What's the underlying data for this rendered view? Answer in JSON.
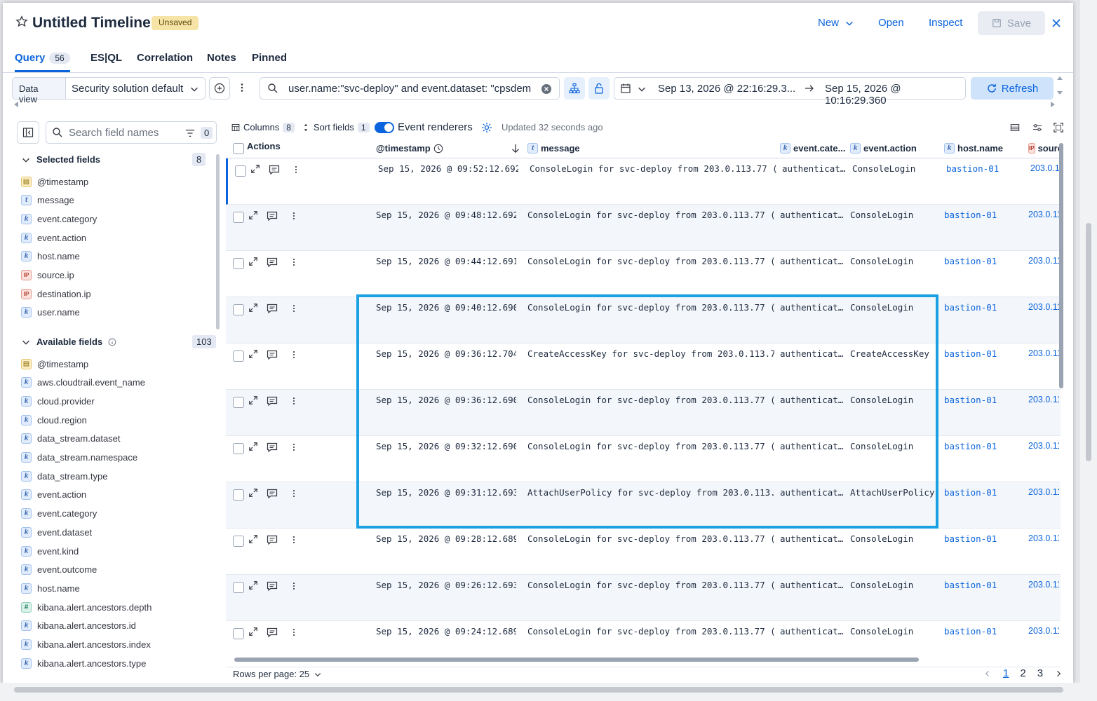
{
  "header": {
    "title": "Untitled Timeline",
    "badge": "Unsaved",
    "new_label": "New",
    "open_label": "Open",
    "inspect_label": "Inspect",
    "save_label": "Save"
  },
  "tabs": [
    {
      "label": "Query",
      "count": "56",
      "active": true
    },
    {
      "label": "ES|QL"
    },
    {
      "label": "Correlation"
    },
    {
      "label": "Notes"
    },
    {
      "label": "Pinned"
    }
  ],
  "querybar": {
    "dataview_label": "Data view",
    "dataview_value": "Security solution default",
    "kql_value": "user.name:\"svc-deploy\" and event.dataset: \"cpsdem",
    "date_start": "Sep 13, 2026 @ 22:16:29.3...",
    "date_end": "Sep 15, 2026 @ 10:16:29.360",
    "refresh_label": "Refresh"
  },
  "sidebar": {
    "search_placeholder": "Search field names",
    "filter_count": "0",
    "selected_label": "Selected fields",
    "selected_count": "8",
    "selected_fields": [
      {
        "type": "d",
        "name": "@timestamp"
      },
      {
        "type": "t",
        "name": "message"
      },
      {
        "type": "k",
        "name": "event.category"
      },
      {
        "type": "k",
        "name": "event.action"
      },
      {
        "type": "k",
        "name": "host.name"
      },
      {
        "type": "ip",
        "name": "source.ip"
      },
      {
        "type": "ip",
        "name": "destination.ip"
      },
      {
        "type": "k",
        "name": "user.name"
      }
    ],
    "available_label": "Available fields",
    "available_count": "103",
    "available_fields": [
      {
        "type": "d",
        "name": "@timestamp"
      },
      {
        "type": "k",
        "name": "aws.cloudtrail.event_name"
      },
      {
        "type": "k",
        "name": "cloud.provider"
      },
      {
        "type": "k",
        "name": "cloud.region"
      },
      {
        "type": "k",
        "name": "data_stream.dataset"
      },
      {
        "type": "k",
        "name": "data_stream.namespace"
      },
      {
        "type": "k",
        "name": "data_stream.type"
      },
      {
        "type": "k",
        "name": "event.action"
      },
      {
        "type": "k",
        "name": "event.category"
      },
      {
        "type": "k",
        "name": "event.dataset"
      },
      {
        "type": "k",
        "name": "event.kind"
      },
      {
        "type": "k",
        "name": "event.outcome"
      },
      {
        "type": "k",
        "name": "host.name"
      },
      {
        "type": "n",
        "name": "kibana.alert.ancestors.depth"
      },
      {
        "type": "k",
        "name": "kibana.alert.ancestors.id"
      },
      {
        "type": "k",
        "name": "kibana.alert.ancestors.index"
      },
      {
        "type": "k",
        "name": "kibana.alert.ancestors.type"
      }
    ]
  },
  "grid": {
    "columns_label": "Columns",
    "columns_count": "8",
    "sort_label": "Sort fields",
    "sort_count": "1",
    "renderers_label": "Event renderers",
    "updated_text": "Updated 32 seconds ago",
    "headers": {
      "actions": "Actions",
      "timestamp": "@timestamp",
      "message": "message",
      "category": "event.cate...",
      "action": "event.action",
      "host": "host.name",
      "source": "sourc"
    },
    "rows": [
      {
        "ts": "Sep 15, 2026 @ 09:52:12.692",
        "msg": "ConsoleLogin for svc-deploy from 203.0.113.77 (…",
        "cat": "authenticat…",
        "act": "ConsoleLogin",
        "host": "bastion-01",
        "src": "203.0.11"
      },
      {
        "ts": "Sep 15, 2026 @ 09:48:12.692",
        "msg": "ConsoleLogin for svc-deploy from 203.0.113.77 (…",
        "cat": "authenticat…",
        "act": "ConsoleLogin",
        "host": "bastion-01",
        "src": "203.0.11"
      },
      {
        "ts": "Sep 15, 2026 @ 09:44:12.691",
        "msg": "ConsoleLogin for svc-deploy from 203.0.113.77 (…",
        "cat": "authenticat…",
        "act": "ConsoleLogin",
        "host": "bastion-01",
        "src": "203.0.11"
      },
      {
        "ts": "Sep 15, 2026 @ 09:40:12.690",
        "msg": "ConsoleLogin for svc-deploy from 203.0.113.77 (…",
        "cat": "authenticat…",
        "act": "ConsoleLogin",
        "host": "bastion-01",
        "src": "203.0.11"
      },
      {
        "ts": "Sep 15, 2026 @ 09:36:12.704",
        "msg": "CreateAccessKey for svc-deploy from 203.0.113.7…",
        "cat": "authenticat…",
        "act": "CreateAccessKey",
        "host": "bastion-01",
        "src": "203.0.11"
      },
      {
        "ts": "Sep 15, 2026 @ 09:36:12.690",
        "msg": "ConsoleLogin for svc-deploy from 203.0.113.77 (…",
        "cat": "authenticat…",
        "act": "ConsoleLogin",
        "host": "bastion-01",
        "src": "203.0.11"
      },
      {
        "ts": "Sep 15, 2026 @ 09:32:12.690",
        "msg": "ConsoleLogin for svc-deploy from 203.0.113.77 (…",
        "cat": "authenticat…",
        "act": "ConsoleLogin",
        "host": "bastion-01",
        "src": "203.0.11"
      },
      {
        "ts": "Sep 15, 2026 @ 09:31:12.693",
        "msg": "AttachUserPolicy for svc-deploy from 203.0.113.…",
        "cat": "authenticat…",
        "act": "AttachUserPolicy",
        "host": "bastion-01",
        "src": "203.0.11"
      },
      {
        "ts": "Sep 15, 2026 @ 09:28:12.689",
        "msg": "ConsoleLogin for svc-deploy from 203.0.113.77 (…",
        "cat": "authenticat…",
        "act": "ConsoleLogin",
        "host": "bastion-01",
        "src": "203.0.11"
      },
      {
        "ts": "Sep 15, 2026 @ 09:26:12.693",
        "msg": "ConsoleLogin for svc-deploy from 203.0.113.77 (…",
        "cat": "authenticat…",
        "act": "ConsoleLogin",
        "host": "bastion-01",
        "src": "203.0.11"
      },
      {
        "ts": "Sep 15, 2026 @ 09:24:12.689",
        "msg": "ConsoleLogin for svc-deploy from 203.0.113.77 (…",
        "cat": "authenticat…",
        "act": "ConsoleLogin",
        "host": "bastion-01",
        "src": "203.0.11"
      }
    ],
    "rows_per_page": "Rows per page: 25",
    "pages": [
      "1",
      "2",
      "3"
    ]
  },
  "colors": {
    "accent": "#0b64dd",
    "highlight": "#1ba1e2"
  }
}
